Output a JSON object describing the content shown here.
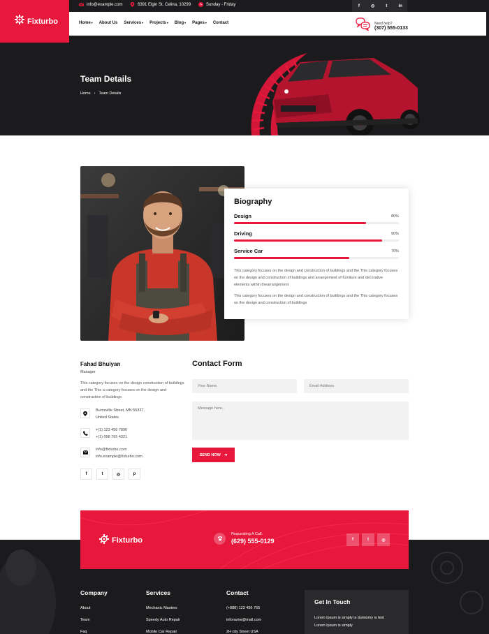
{
  "topbar": {
    "email": "info@example.com",
    "address": "6391 Elgin St. Celina, 10299",
    "hours": "Sunday - Friday",
    "socials": [
      "f",
      "◎",
      "t",
      "in"
    ]
  },
  "brand": {
    "name": "Fixturbo",
    "color": "#e8173c"
  },
  "nav": {
    "items": [
      {
        "label": "Home",
        "dropdown": true
      },
      {
        "label": "About Us",
        "dropdown": false
      },
      {
        "label": "Services",
        "dropdown": true
      },
      {
        "label": "Projects",
        "dropdown": true
      },
      {
        "label": "Blog",
        "dropdown": true
      },
      {
        "label": "Pages",
        "dropdown": true
      },
      {
        "label": "Contact",
        "dropdown": false
      }
    ],
    "help_label": "Need help?",
    "help_phone": "(307) 555-0133"
  },
  "hero": {
    "title": "Team Details",
    "breadcrumb": [
      "Home",
      "Team Details"
    ]
  },
  "biography": {
    "title": "Biography",
    "skills": [
      {
        "name": "Design",
        "percent_label": "80%",
        "value": 0.8
      },
      {
        "name": "Driving",
        "percent_label": "90%",
        "value": 0.9
      },
      {
        "name": "Service Car",
        "percent_label": "70%",
        "value": 0.7
      }
    ],
    "paragraph1": "This category focuses on the design and construction of buildings and the This category focuses on the design and construction of buildings and arrangement of furniture and decorative elements within thearrangement",
    "paragraph2": "This category focuses on the design and construction of buildings and the This category focuses on the design and construction of buildings"
  },
  "person": {
    "name": "Fahad Bhuiyan",
    "role": "Manager",
    "description": "This category focuses on the design construction of buildings and the This a category focuses on the design and construction of buildings",
    "address_line1": "Burnsville Street, MN 55337,",
    "address_line2": "United States",
    "phone1": "+(1) 123 456 7890",
    "phone2": "+(1) 098 765 4321",
    "email1": "info@fixturbo.com",
    "email2": "info.example@fixturbo.com",
    "socials": [
      "f",
      "t",
      "◎",
      "p"
    ]
  },
  "contact_form": {
    "title": "Contact Form",
    "name_placeholder": "Your Name",
    "email_placeholder": "Email Address",
    "message_placeholder": "Message here..",
    "send_label": "SEND NOW"
  },
  "cta": {
    "brand": "Fixturbo",
    "call_label": "Requesting A Call:",
    "call_phone": "(629) 555-0129",
    "socials": [
      "f",
      "t",
      "◎"
    ]
  },
  "footer": {
    "company": {
      "title": "Company",
      "links": [
        "About",
        "Team",
        "Faq"
      ]
    },
    "services": {
      "title": "Services",
      "links": [
        "Mechanic Masters",
        "Speedy Auto Repair",
        "Mobile Car Repair"
      ]
    },
    "contact": {
      "title": "Contact",
      "links": [
        "(+888) 123 456 765",
        "infoname@mail.com",
        "2H city Street USA"
      ]
    },
    "get_in_touch": {
      "title": "Get In Touch",
      "line1": "Lorem Ipsum is simply is dumiomy is text",
      "line2": "Lorem Ipsum is simply"
    }
  }
}
